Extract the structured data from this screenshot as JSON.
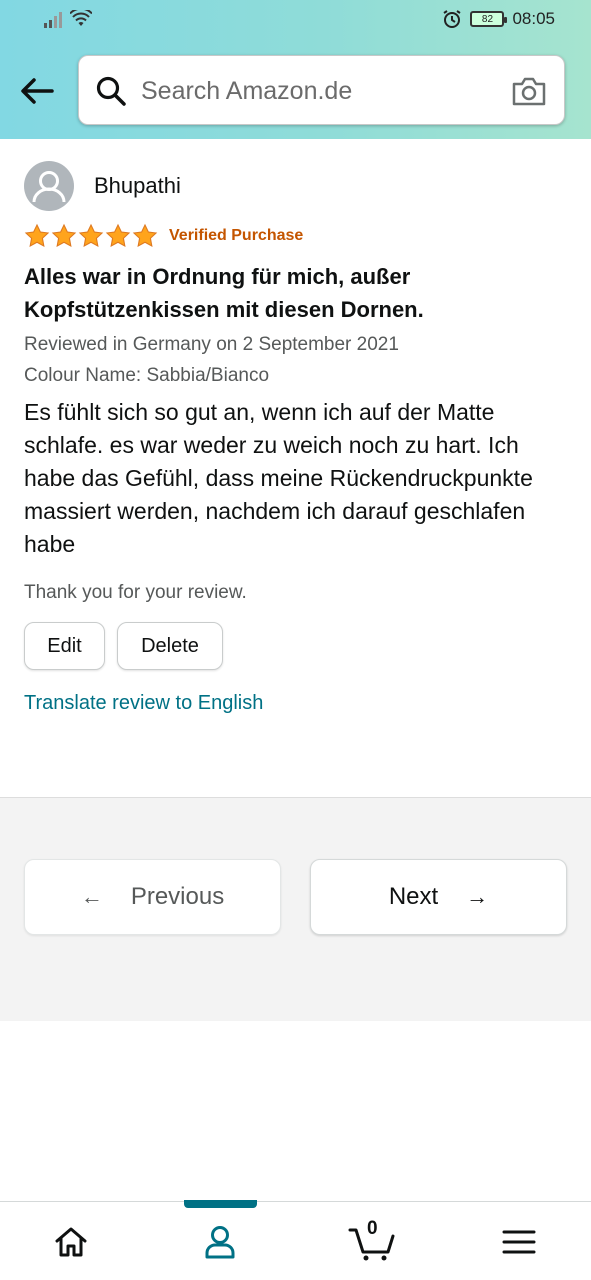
{
  "status_bar": {
    "time": "08:05",
    "battery": "82"
  },
  "header": {
    "search_placeholder": "Search Amazon.de",
    "icons": [
      "back-arrow-icon",
      "search-icon",
      "camera-icon"
    ]
  },
  "review": {
    "reviewer_name": "Bhupathi",
    "rating": 5,
    "rating_max": 5,
    "verified_label": "Verified Purchase",
    "title": "Alles war in Ordnung für mich, außer Kopfstützenkissen mit diesen Dornen.",
    "reviewed_in": "Reviewed in Germany on 2 September 2021",
    "colour_name": "Colour Name: Sabbia/Bianco",
    "body": "Es fühlt sich so gut an, wenn ich auf der Matte schlafe. es war weder zu weich noch zu hart. Ich habe das Gefühl, dass meine Rückendruckpunkte massiert werden, nachdem ich darauf geschlafen habe",
    "thanks": "Thank you for your review.",
    "edit_label": "Edit",
    "delete_label": "Delete",
    "translate_label": "Translate review to English"
  },
  "pagination": {
    "previous_label": "Previous",
    "next_label": "Next",
    "previous_arrow": "←",
    "next_arrow": "→"
  },
  "bottom_nav": {
    "cart_count": "0",
    "items": [
      "home-icon",
      "profile-icon",
      "cart-icon",
      "menu-icon"
    ],
    "active": "profile-icon"
  },
  "colors": {
    "accent": "#007185",
    "verified": "#c45500",
    "star": "#ffa41c"
  }
}
